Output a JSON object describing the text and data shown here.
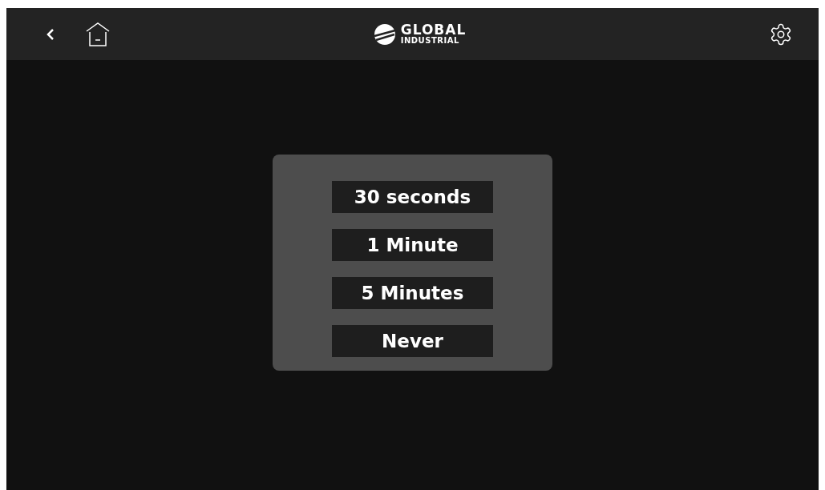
{
  "header": {
    "logo": {
      "line_1": "GLOBAL",
      "line_2": "INDUSTRIAL"
    }
  },
  "options": [
    {
      "label": "30 seconds"
    },
    {
      "label": "1 Minute"
    },
    {
      "label": "5 Minutes"
    },
    {
      "label": "Never"
    }
  ]
}
